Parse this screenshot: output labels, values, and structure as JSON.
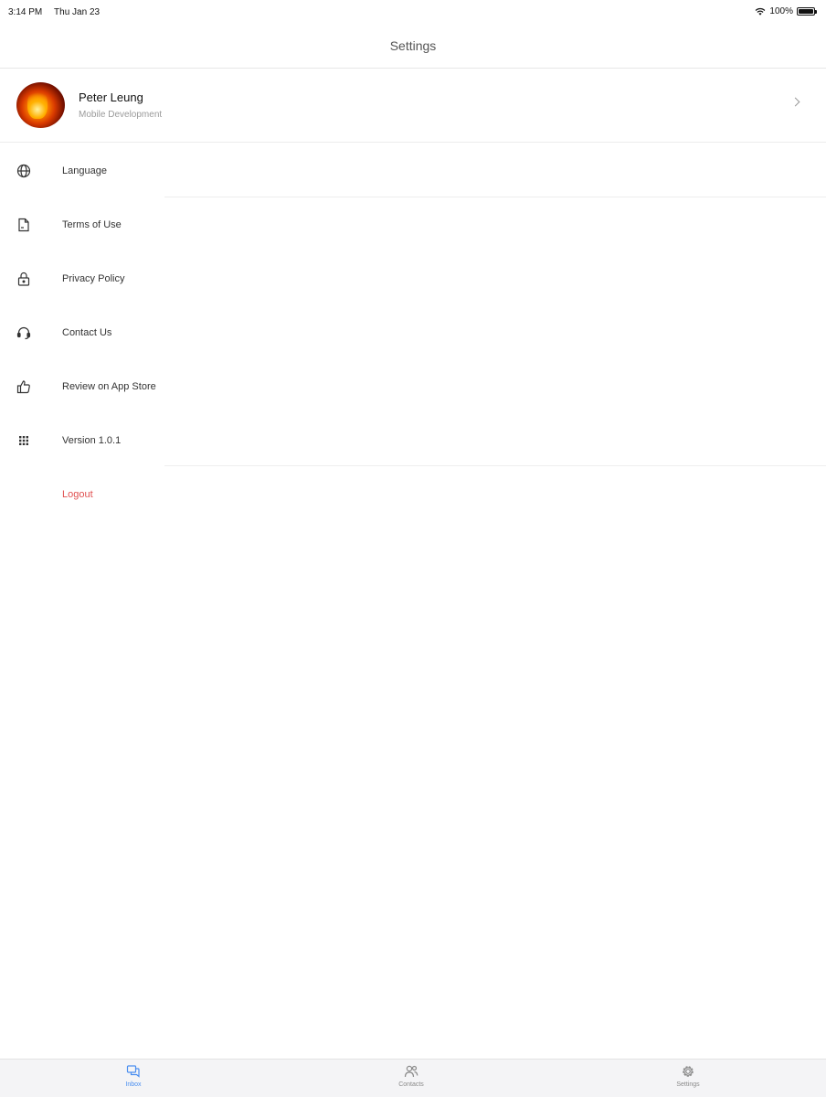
{
  "status_bar": {
    "time": "3:14 PM",
    "date": "Thu Jan 23",
    "battery_percent": "100%",
    "battery_level": 1.0
  },
  "nav": {
    "title": "Settings"
  },
  "profile": {
    "name": "Peter Leung",
    "subtitle": "Mobile Development"
  },
  "menu": {
    "items": [
      {
        "label": "Language",
        "icon": "globe-icon"
      },
      {
        "label": "Terms of Use",
        "icon": "document-icon"
      },
      {
        "label": "Privacy Policy",
        "icon": "lock-icon"
      },
      {
        "label": "Contact Us",
        "icon": "headset-icon"
      },
      {
        "label": "Review on App Store",
        "icon": "thumbs-up-icon"
      },
      {
        "label": "Version 1.0.1",
        "icon": "grid-icon"
      }
    ],
    "logout_label": "Logout"
  },
  "tabs": [
    {
      "label": "Inbox",
      "icon": "chat-icon",
      "active": true
    },
    {
      "label": "Contacts",
      "icon": "contacts-icon",
      "active": false
    },
    {
      "label": "Settings",
      "icon": "gear-icon",
      "active": false
    }
  ],
  "colors": {
    "accent": "#4a8ef0",
    "logout": "#e05050"
  }
}
